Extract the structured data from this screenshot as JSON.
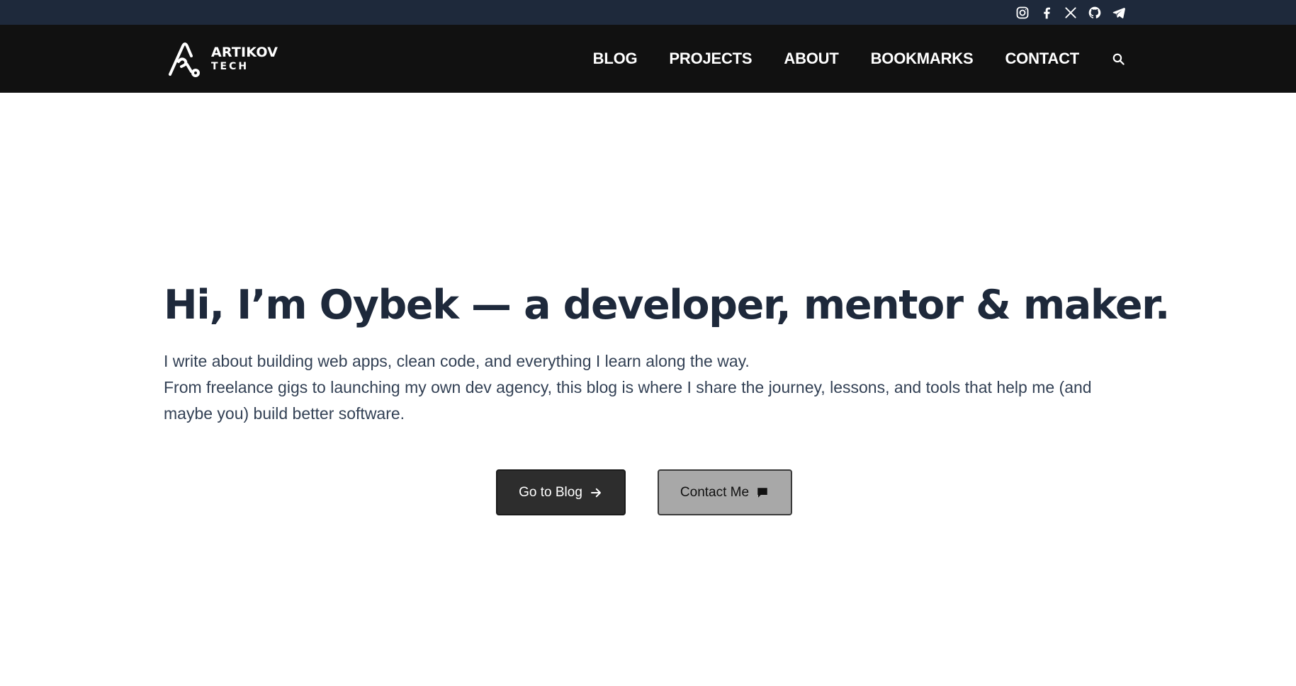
{
  "topbar": {
    "social": [
      {
        "icon": "instagram-icon"
      },
      {
        "icon": "facebook-icon"
      },
      {
        "icon": "x-icon"
      },
      {
        "icon": "github-icon"
      },
      {
        "icon": "telegram-icon"
      }
    ]
  },
  "brand": {
    "line1": "ARTIKOV",
    "line2": "TECH"
  },
  "nav": {
    "items": [
      "BLOG",
      "PROJECTS",
      "ABOUT",
      "BOOKMARKS",
      "CONTACT"
    ],
    "search_icon": "search-icon"
  },
  "hero": {
    "title": "Hi, I’m Oybek — a developer, mentor & maker.",
    "line1": "I write about building web apps, clean code, and everything I learn along the way.",
    "line2": "From freelance gigs to launching my own dev agency, this blog is where I share the journey, lessons, and tools that help me (and maybe you) build better software."
  },
  "buttons": {
    "primary_label": "Go to Blog",
    "primary_icon": "arrow-right-icon",
    "secondary_label": "Contact Me",
    "secondary_icon": "chat-bubble-icon"
  },
  "colors": {
    "topbar_bg": "#1e293b",
    "navbar_bg": "#111111",
    "heading": "#1e293b",
    "text": "#334155",
    "primary_button": "#2d2d2d",
    "secondary_button": "#a8a8a8"
  }
}
